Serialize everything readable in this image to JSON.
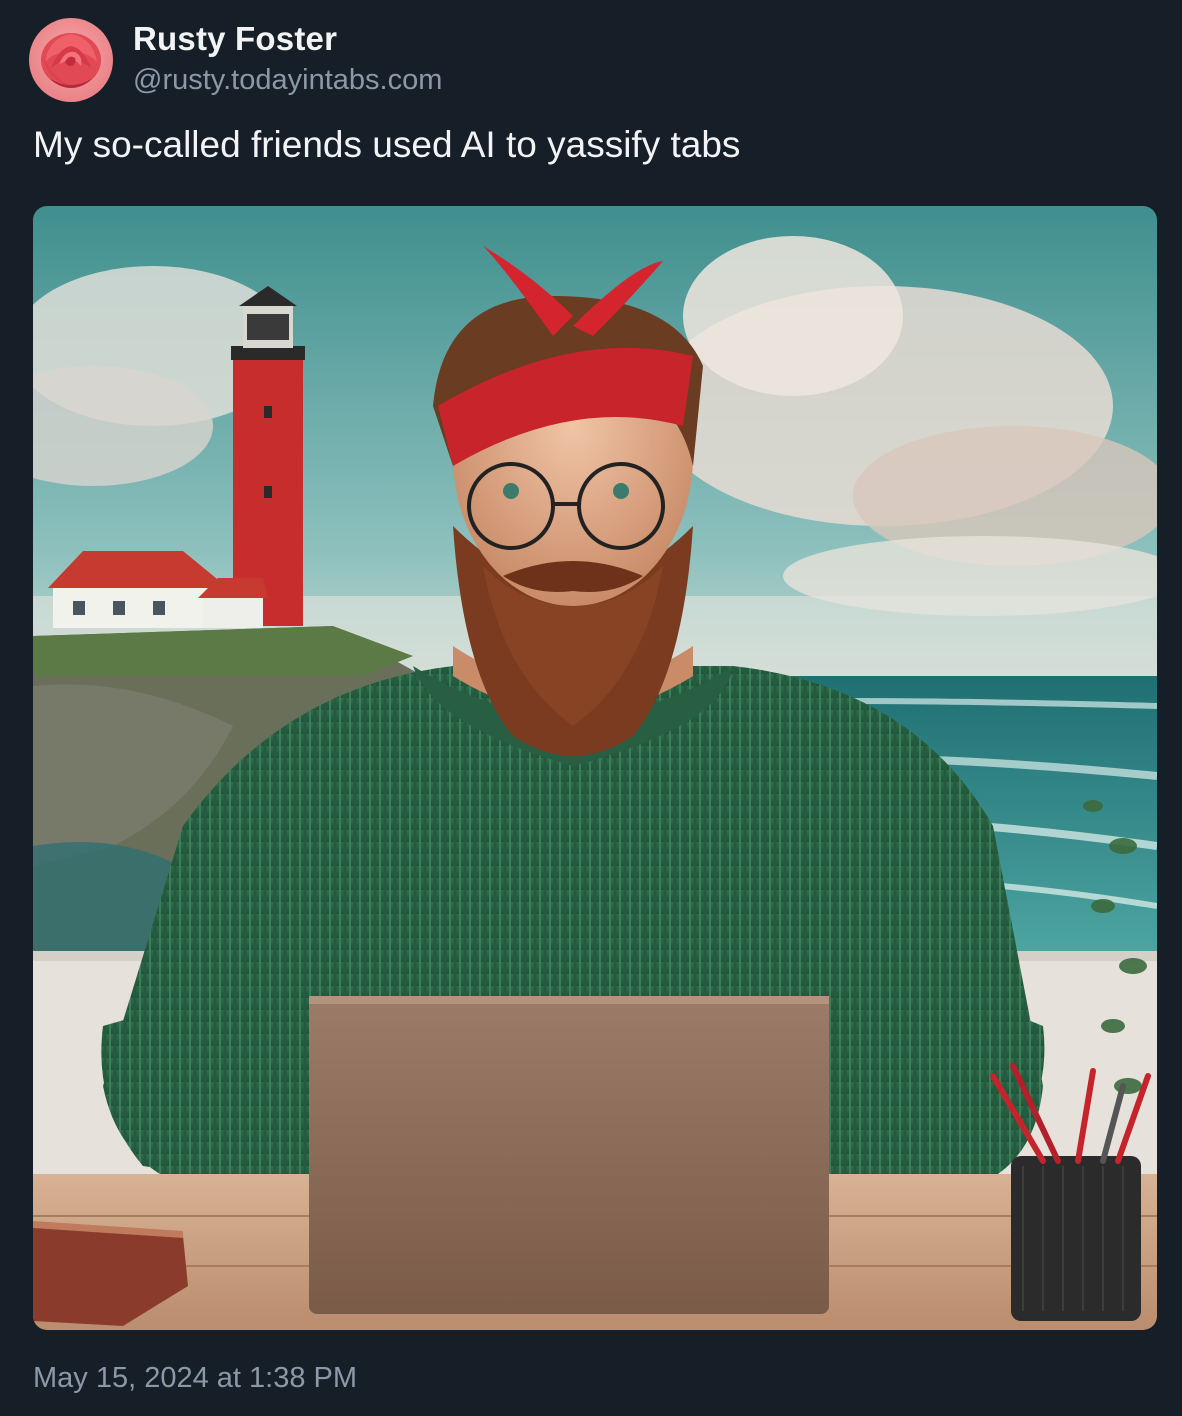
{
  "post": {
    "author_name": "Rusty Foster",
    "author_handle": "@rusty.todayintabs.com",
    "avatar_icon": "rose-avatar-icon",
    "text": "My so-called friends used AI to yassify tabs",
    "timestamp": "May 15, 2024 at 1:38 PM"
  },
  "image": {
    "icon": "embedded-photo",
    "subject": "bearded-man-at-laptop-with-lighthouse-painting"
  },
  "colors": {
    "background": "#161e27",
    "primary_text": "#f1f3f5",
    "secondary_text": "#8a98a8"
  }
}
